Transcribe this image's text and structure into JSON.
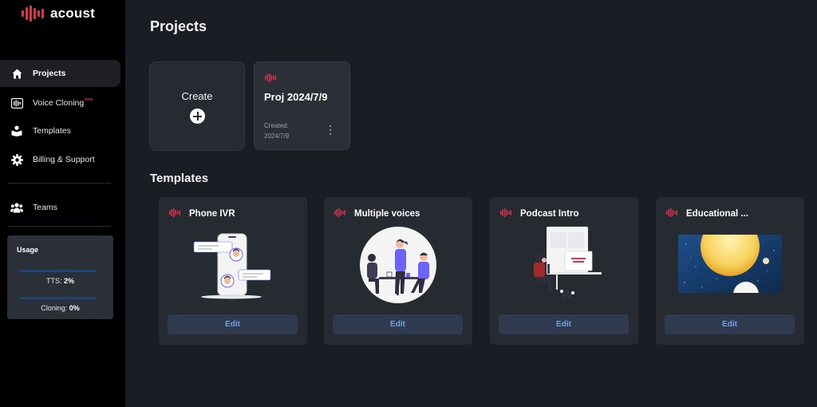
{
  "app": {
    "name": "acoust",
    "brand_color": "#e0314b"
  },
  "sidebar": {
    "items": [
      {
        "label": "Projects",
        "icon": "home-icon",
        "active": true
      },
      {
        "label": "Voice Cloning",
        "icon": "waveform-icon",
        "badge": "new"
      },
      {
        "label": "Templates",
        "icon": "book-user-icon"
      },
      {
        "label": "Billing & Support",
        "icon": "gear-icon"
      },
      {
        "label": "Teams",
        "icon": "users-icon"
      }
    ],
    "usage": {
      "title": "Usage",
      "tts_label": "TTS:",
      "tts_value": "2%",
      "cloning_label": "Cloning:",
      "cloning_value": "0%"
    }
  },
  "main": {
    "title": "Projects",
    "create_label": "Create",
    "projects": [
      {
        "title": "Proj 2024/7/9",
        "created_label": "Created:",
        "created_date": "2024/7/9"
      }
    ],
    "templates_title": "Templates",
    "templates": [
      {
        "title": "Phone IVR",
        "button": "Edit",
        "illustration": "phone-chat-illustration"
      },
      {
        "title": "Multiple voices",
        "button": "Edit",
        "illustration": "people-meeting-illustration"
      },
      {
        "title": "Podcast Intro",
        "button": "Edit",
        "illustration": "podcast-desk-illustration"
      },
      {
        "title": "Educational ...",
        "button": "Edit",
        "illustration": "planets-illustration"
      }
    ]
  }
}
